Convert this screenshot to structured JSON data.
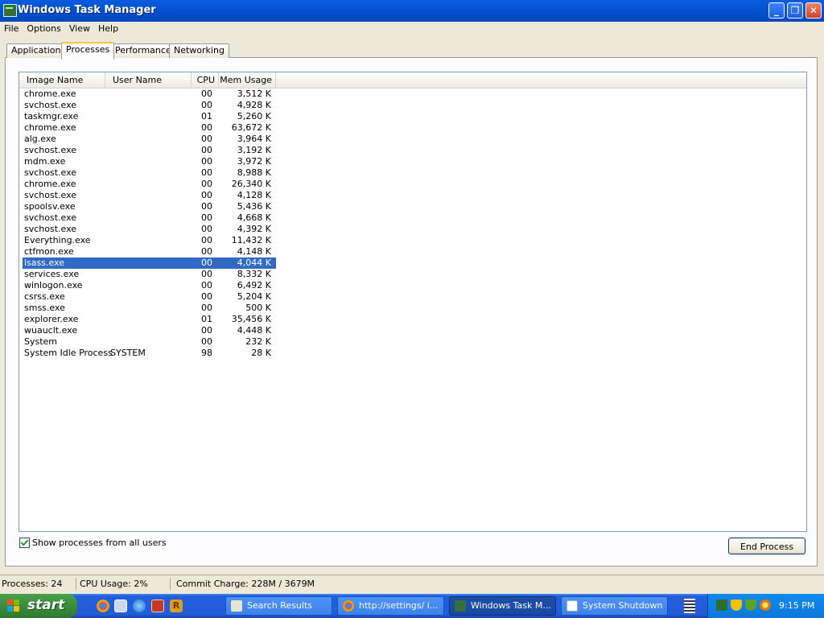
{
  "window": {
    "title": "Windows Task Manager",
    "minimize_glyph": "_",
    "maximize_glyph": "❐",
    "close_glyph": "✕"
  },
  "menu": [
    "File",
    "Options",
    "View",
    "Help"
  ],
  "tabs": [
    {
      "label": "Applications",
      "active": false
    },
    {
      "label": "Processes",
      "active": true
    },
    {
      "label": "Performance",
      "active": false
    },
    {
      "label": "Networking",
      "active": false
    }
  ],
  "columns": {
    "image_name": "Image Name",
    "user_name": "User Name",
    "cpu": "CPU",
    "mem_usage": "Mem Usage"
  },
  "processes": [
    {
      "name": "chrome.exe",
      "user": "",
      "cpu": "00",
      "mem": "3,512 K"
    },
    {
      "name": "svchost.exe",
      "user": "",
      "cpu": "00",
      "mem": "4,928 K"
    },
    {
      "name": "taskmgr.exe",
      "user": "",
      "cpu": "01",
      "mem": "5,260 K"
    },
    {
      "name": "chrome.exe",
      "user": "",
      "cpu": "00",
      "mem": "63,672 K"
    },
    {
      "name": "alg.exe",
      "user": "",
      "cpu": "00",
      "mem": "3,964 K"
    },
    {
      "name": "svchost.exe",
      "user": "",
      "cpu": "00",
      "mem": "3,192 K"
    },
    {
      "name": "mdm.exe",
      "user": "",
      "cpu": "00",
      "mem": "3,972 K"
    },
    {
      "name": "svchost.exe",
      "user": "",
      "cpu": "00",
      "mem": "8,988 K"
    },
    {
      "name": "chrome.exe",
      "user": "",
      "cpu": "00",
      "mem": "26,340 K"
    },
    {
      "name": "svchost.exe",
      "user": "",
      "cpu": "00",
      "mem": "4,128 K"
    },
    {
      "name": "spoolsv.exe",
      "user": "",
      "cpu": "00",
      "mem": "5,436 K"
    },
    {
      "name": "svchost.exe",
      "user": "",
      "cpu": "00",
      "mem": "4,668 K"
    },
    {
      "name": "svchost.exe",
      "user": "",
      "cpu": "00",
      "mem": "4,392 K"
    },
    {
      "name": "Everything.exe",
      "user": "",
      "cpu": "00",
      "mem": "11,432 K"
    },
    {
      "name": "ctfmon.exe",
      "user": "",
      "cpu": "00",
      "mem": "4,148 K"
    },
    {
      "name": "lsass.exe",
      "user": "",
      "cpu": "00",
      "mem": "4,044 K",
      "selected": true
    },
    {
      "name": "services.exe",
      "user": "",
      "cpu": "00",
      "mem": "8,332 K"
    },
    {
      "name": "winlogon.exe",
      "user": "",
      "cpu": "00",
      "mem": "6,492 K"
    },
    {
      "name": "csrss.exe",
      "user": "",
      "cpu": "00",
      "mem": "5,204 K"
    },
    {
      "name": "smss.exe",
      "user": "",
      "cpu": "00",
      "mem": "500 K"
    },
    {
      "name": "explorer.exe",
      "user": "",
      "cpu": "01",
      "mem": "35,456 K"
    },
    {
      "name": "wuauclt.exe",
      "user": "",
      "cpu": "00",
      "mem": "4,448 K"
    },
    {
      "name": "System",
      "user": "",
      "cpu": "00",
      "mem": "232 K"
    },
    {
      "name": "System Idle Process",
      "user": "SYSTEM",
      "cpu": "98",
      "mem": "28 K"
    }
  ],
  "show_all_users": {
    "label": "Show processes from all users",
    "checked": true
  },
  "end_process_label": "End Process",
  "status": {
    "processes": "Processes: 24",
    "cpu_usage": "CPU Usage: 2%",
    "commit_charge": "Commit Charge: 228M / 3679M"
  },
  "taskbar": {
    "start_label": "start",
    "buttons": [
      {
        "label": "Search Results",
        "icon": "search-results-icon",
        "icon_color": "#e8e4d4",
        "active": false
      },
      {
        "label": "http://settings/ i...",
        "icon": "chrome-icon",
        "icon_color": "#dd4b39",
        "active": false
      },
      {
        "label": "Windows Task M...",
        "icon": "task-manager-icon",
        "icon_color": "#3b6c3b",
        "active": true
      },
      {
        "label": "System Shutdown",
        "icon": "window-icon",
        "icon_color": "#ffffff",
        "active": false
      }
    ],
    "clock": "9:15 PM"
  },
  "colors": {
    "selection": "#316ac5",
    "title_bar": "#0453d6",
    "start_button": "#3b8c3c"
  }
}
